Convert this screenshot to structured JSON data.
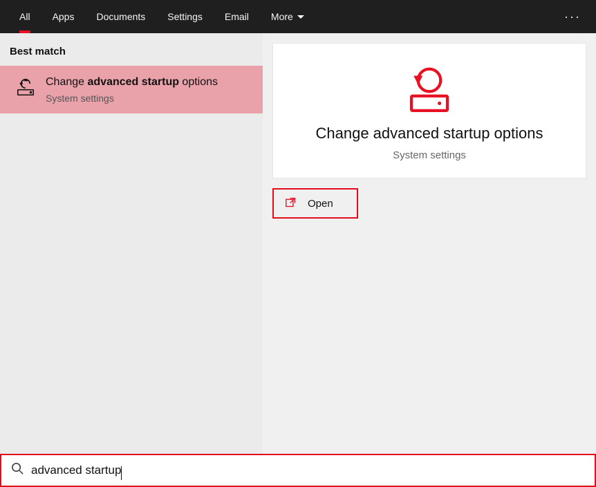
{
  "tabs": {
    "all": "All",
    "apps": "Apps",
    "documents": "Documents",
    "settings": "Settings",
    "email": "Email",
    "more": "More"
  },
  "section": {
    "best_match": "Best match"
  },
  "result": {
    "title_prefix": "Change ",
    "title_bold": "advanced startup",
    "title_suffix": " options",
    "subtitle": "System settings"
  },
  "detail": {
    "title": "Change advanced startup options",
    "subtitle": "System settings"
  },
  "actions": {
    "open": "Open"
  },
  "search": {
    "query": "advanced startup"
  },
  "colors": {
    "accent": "#e81123",
    "highlight": "#e30b1c",
    "result_bg": "#e9a2aa"
  }
}
